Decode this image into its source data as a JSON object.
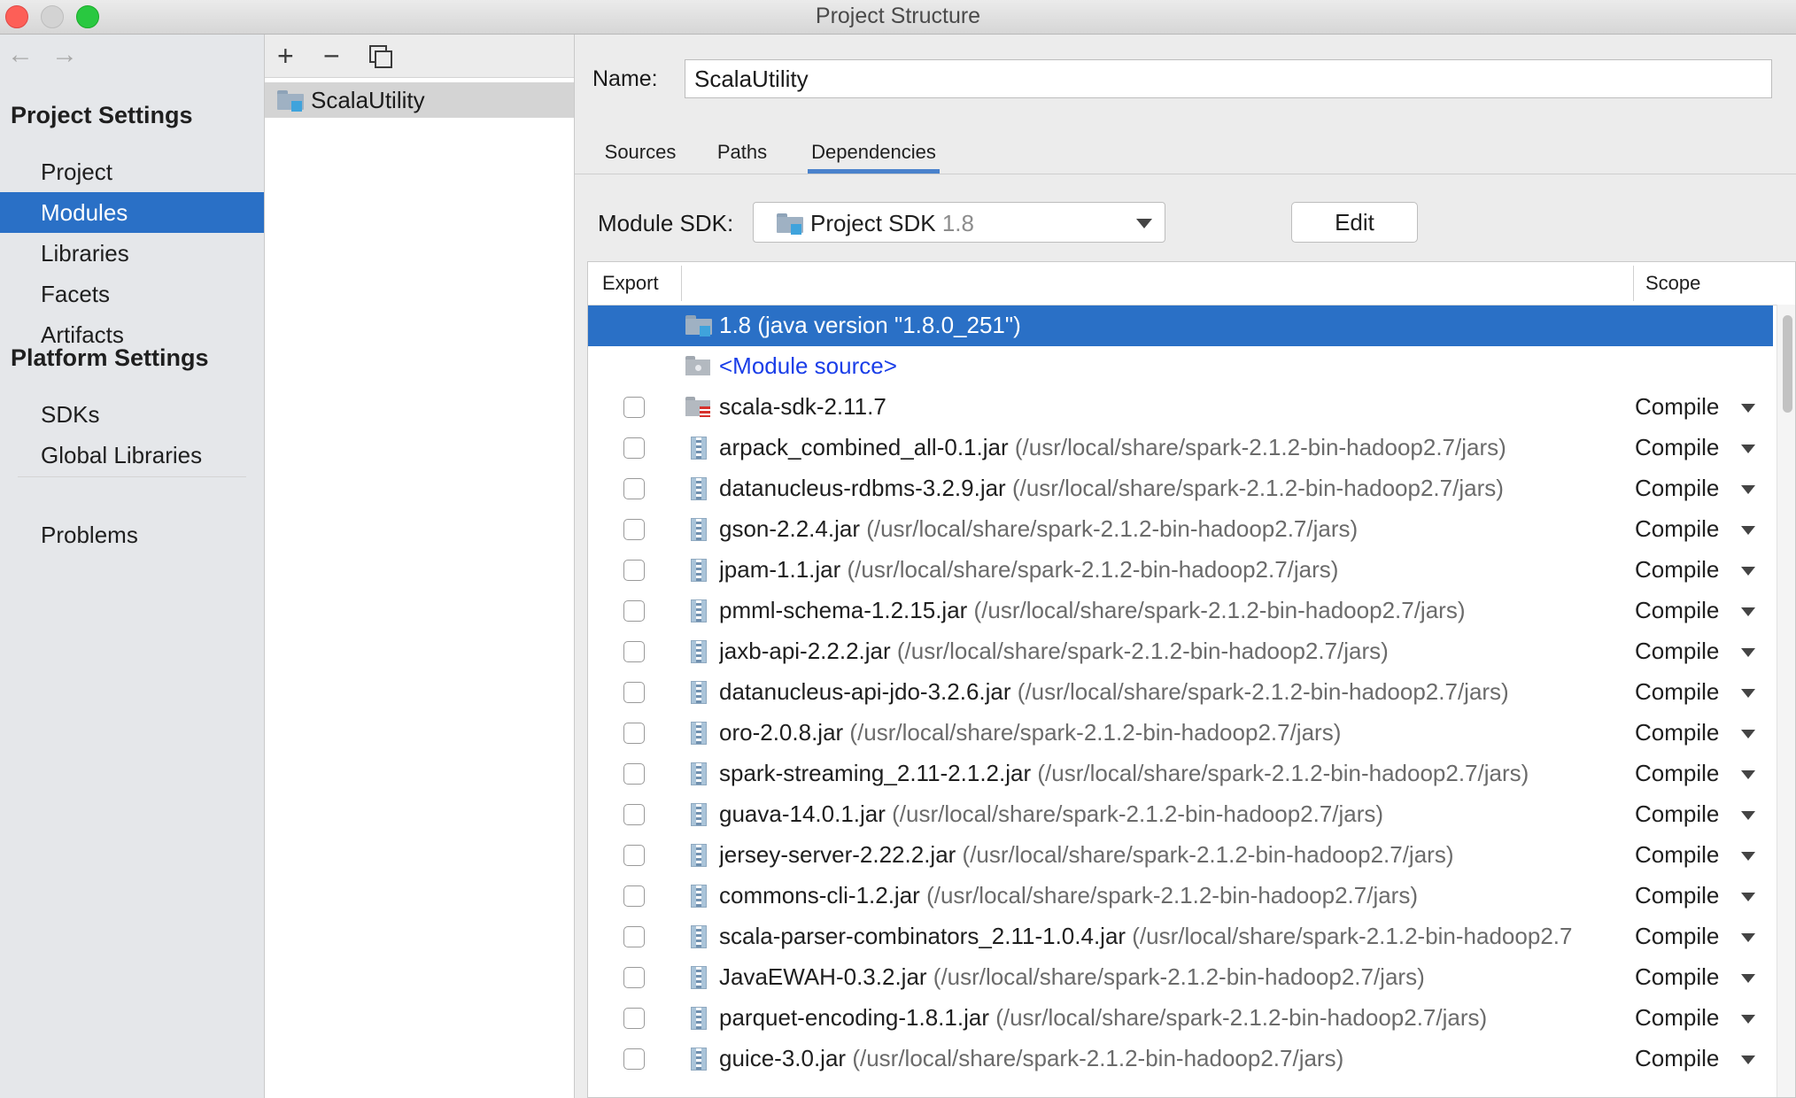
{
  "window": {
    "title": "Project Structure"
  },
  "nav": {
    "back_icon": "arrow-left-icon",
    "forward_icon": "arrow-right-icon",
    "sections": [
      {
        "header": "Project Settings",
        "items": [
          "Project",
          "Modules",
          "Libraries",
          "Facets",
          "Artifacts"
        ]
      },
      {
        "header": "Platform Settings",
        "items": [
          "SDKs",
          "Global Libraries"
        ]
      }
    ],
    "bottom_item": "Problems",
    "selected": "Modules"
  },
  "module_panel": {
    "add_label": "+",
    "remove_label": "−",
    "modules": [
      "ScalaUtility"
    ]
  },
  "content": {
    "name_label": "Name:",
    "name_value": "ScalaUtility",
    "tabs": [
      "Sources",
      "Paths",
      "Dependencies"
    ],
    "active_tab": "Dependencies",
    "sdk_label": "Module SDK:",
    "sdk_value": "Project SDK",
    "sdk_version": "1.8",
    "edit_label": "Edit"
  },
  "dependencies": {
    "columns": {
      "export": "Export",
      "scope": "Scope"
    },
    "rows": [
      {
        "name": "1.8 (java version \"1.8.0_251\")",
        "path": "",
        "scope": "",
        "kind": "jdk",
        "selected": true
      },
      {
        "name": "<Module source>",
        "path": "",
        "scope": "",
        "kind": "source"
      },
      {
        "name": "scala-sdk-2.11.7",
        "path": "",
        "scope": "Compile",
        "kind": "scala"
      },
      {
        "name": "arpack_combined_all-0.1.jar",
        "path": "(/usr/local/share/spark-2.1.2-bin-hadoop2.7/jars)",
        "scope": "Compile",
        "kind": "jar"
      },
      {
        "name": "datanucleus-rdbms-3.2.9.jar",
        "path": "(/usr/local/share/spark-2.1.2-bin-hadoop2.7/jars)",
        "scope": "Compile",
        "kind": "jar"
      },
      {
        "name": "gson-2.2.4.jar",
        "path": "(/usr/local/share/spark-2.1.2-bin-hadoop2.7/jars)",
        "scope": "Compile",
        "kind": "jar"
      },
      {
        "name": "jpam-1.1.jar",
        "path": "(/usr/local/share/spark-2.1.2-bin-hadoop2.7/jars)",
        "scope": "Compile",
        "kind": "jar"
      },
      {
        "name": "pmml-schema-1.2.15.jar",
        "path": "(/usr/local/share/spark-2.1.2-bin-hadoop2.7/jars)",
        "scope": "Compile",
        "kind": "jar"
      },
      {
        "name": "jaxb-api-2.2.2.jar",
        "path": "(/usr/local/share/spark-2.1.2-bin-hadoop2.7/jars)",
        "scope": "Compile",
        "kind": "jar"
      },
      {
        "name": "datanucleus-api-jdo-3.2.6.jar",
        "path": "(/usr/local/share/spark-2.1.2-bin-hadoop2.7/jars)",
        "scope": "Compile",
        "kind": "jar"
      },
      {
        "name": "oro-2.0.8.jar",
        "path": "(/usr/local/share/spark-2.1.2-bin-hadoop2.7/jars)",
        "scope": "Compile",
        "kind": "jar"
      },
      {
        "name": "spark-streaming_2.11-2.1.2.jar",
        "path": "(/usr/local/share/spark-2.1.2-bin-hadoop2.7/jars)",
        "scope": "Compile",
        "kind": "jar"
      },
      {
        "name": "guava-14.0.1.jar",
        "path": "(/usr/local/share/spark-2.1.2-bin-hadoop2.7/jars)",
        "scope": "Compile",
        "kind": "jar"
      },
      {
        "name": "jersey-server-2.22.2.jar",
        "path": "(/usr/local/share/spark-2.1.2-bin-hadoop2.7/jars)",
        "scope": "Compile",
        "kind": "jar"
      },
      {
        "name": "commons-cli-1.2.jar",
        "path": "(/usr/local/share/spark-2.1.2-bin-hadoop2.7/jars)",
        "scope": "Compile",
        "kind": "jar"
      },
      {
        "name": "scala-parser-combinators_2.11-1.0.4.jar",
        "path": "(/usr/local/share/spark-2.1.2-bin-hadoop2.7",
        "scope": "Compile",
        "kind": "jar"
      },
      {
        "name": "JavaEWAH-0.3.2.jar",
        "path": "(/usr/local/share/spark-2.1.2-bin-hadoop2.7/jars)",
        "scope": "Compile",
        "kind": "jar"
      },
      {
        "name": "parquet-encoding-1.8.1.jar",
        "path": "(/usr/local/share/spark-2.1.2-bin-hadoop2.7/jars)",
        "scope": "Compile",
        "kind": "jar"
      },
      {
        "name": "guice-3.0.jar",
        "path": "(/usr/local/share/spark-2.1.2-bin-hadoop2.7/jars)",
        "scope": "Compile",
        "kind": "jar"
      }
    ]
  },
  "colors": {
    "selection": "#2a70c6",
    "link": "#1a3ee8",
    "path_text": "#6b6b6b"
  }
}
